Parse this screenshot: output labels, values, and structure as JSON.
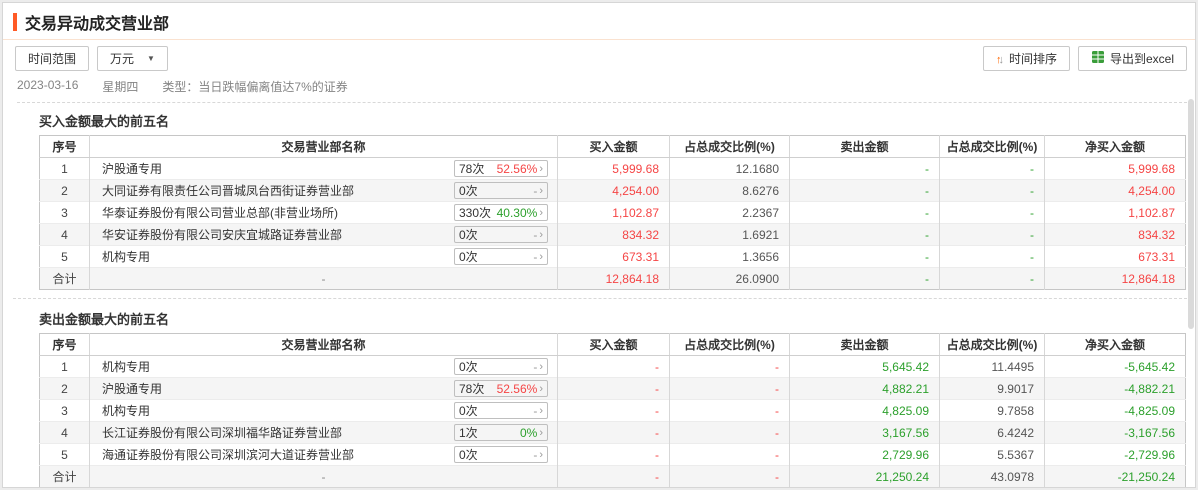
{
  "page": {
    "title": "交易异动成交营业部"
  },
  "toolbar": {
    "time_range_label": "时间范围",
    "unit_selected": "万元",
    "sort_label": "时间排序",
    "export_label": "导出到excel"
  },
  "icons": {
    "sort_up": "↑",
    "sort_down": "↓",
    "dropdown_arrow": "▼",
    "badge_arrow": "›"
  },
  "info": {
    "date": "2023-03-16",
    "weekday": "星期四",
    "type_label": "类型：",
    "type_value": "当日跌幅偏离值达7%的证券"
  },
  "colors": {
    "accent_orange": "#ff5a26",
    "buy_red": "#f54545",
    "sell_green": "#2ca02c"
  },
  "columns": {
    "no": "序号",
    "name": "交易营业部名称",
    "buy": "买入金额",
    "buy_ratio": "占总成交比例(%)",
    "sell": "卖出金额",
    "sell_ratio": "占总成交比例(%)",
    "net": "净买入金额"
  },
  "tables": [
    {
      "section_title": "买入金额最大的前五名",
      "rows": [
        {
          "no": "1",
          "name": "沪股通专用",
          "times": "78次",
          "pct": "52.56%",
          "pct_class": "red",
          "buy": "5,999.68",
          "buy_ratio": "12.1680",
          "sell": "-",
          "sell_ratio": "-",
          "net": "5,999.68"
        },
        {
          "no": "2",
          "name": "大同证券有限责任公司晋城凤台西街证券营业部",
          "times": "0次",
          "pct": "-",
          "pct_class": "gray",
          "buy": "4,254.00",
          "buy_ratio": "8.6276",
          "sell": "-",
          "sell_ratio": "-",
          "net": "4,254.00"
        },
        {
          "no": "3",
          "name": "华泰证券股份有限公司营业总部(非营业场所)",
          "times": "330次",
          "pct": "40.30%",
          "pct_class": "green",
          "buy": "1,102.87",
          "buy_ratio": "2.2367",
          "sell": "-",
          "sell_ratio": "-",
          "net": "1,102.87"
        },
        {
          "no": "4",
          "name": "华安证券股份有限公司安庆宜城路证券营业部",
          "times": "0次",
          "pct": "-",
          "pct_class": "gray",
          "buy": "834.32",
          "buy_ratio": "1.6921",
          "sell": "-",
          "sell_ratio": "-",
          "net": "834.32"
        },
        {
          "no": "5",
          "name": "机构专用",
          "times": "0次",
          "pct": "-",
          "pct_class": "gray",
          "buy": "673.31",
          "buy_ratio": "1.3656",
          "sell": "-",
          "sell_ratio": "-",
          "net": "673.31"
        }
      ],
      "total": {
        "label": "合计",
        "name": "-",
        "buy": "12,864.18",
        "buy_ratio": "26.0900",
        "sell": "-",
        "sell_ratio": "-",
        "net": "12,864.18"
      }
    },
    {
      "section_title": "卖出金额最大的前五名",
      "rows": [
        {
          "no": "1",
          "name": "机构专用",
          "times": "0次",
          "pct": "-",
          "pct_class": "gray",
          "buy": "-",
          "buy_ratio": "-",
          "sell": "5,645.42",
          "sell_ratio": "11.4495",
          "net": "-5,645.42"
        },
        {
          "no": "2",
          "name": "沪股通专用",
          "times": "78次",
          "pct": "52.56%",
          "pct_class": "red",
          "buy": "-",
          "buy_ratio": "-",
          "sell": "4,882.21",
          "sell_ratio": "9.9017",
          "net": "-4,882.21"
        },
        {
          "no": "3",
          "name": "机构专用",
          "times": "0次",
          "pct": "-",
          "pct_class": "gray",
          "buy": "-",
          "buy_ratio": "-",
          "sell": "4,825.09",
          "sell_ratio": "9.7858",
          "net": "-4,825.09"
        },
        {
          "no": "4",
          "name": "长江证券股份有限公司深圳福华路证券营业部",
          "times": "1次",
          "pct": "0%",
          "pct_class": "green",
          "buy": "-",
          "buy_ratio": "-",
          "sell": "3,167.56",
          "sell_ratio": "6.4242",
          "net": "-3,167.56"
        },
        {
          "no": "5",
          "name": "海通证券股份有限公司深圳滨河大道证券营业部",
          "times": "0次",
          "pct": "-",
          "pct_class": "gray",
          "buy": "-",
          "buy_ratio": "-",
          "sell": "2,729.96",
          "sell_ratio": "5.5367",
          "net": "-2,729.96"
        }
      ],
      "total": {
        "label": "合计",
        "name": "-",
        "buy": "-",
        "buy_ratio": "-",
        "sell": "21,250.24",
        "sell_ratio": "43.0978",
        "net": "-21,250.24"
      }
    }
  ]
}
